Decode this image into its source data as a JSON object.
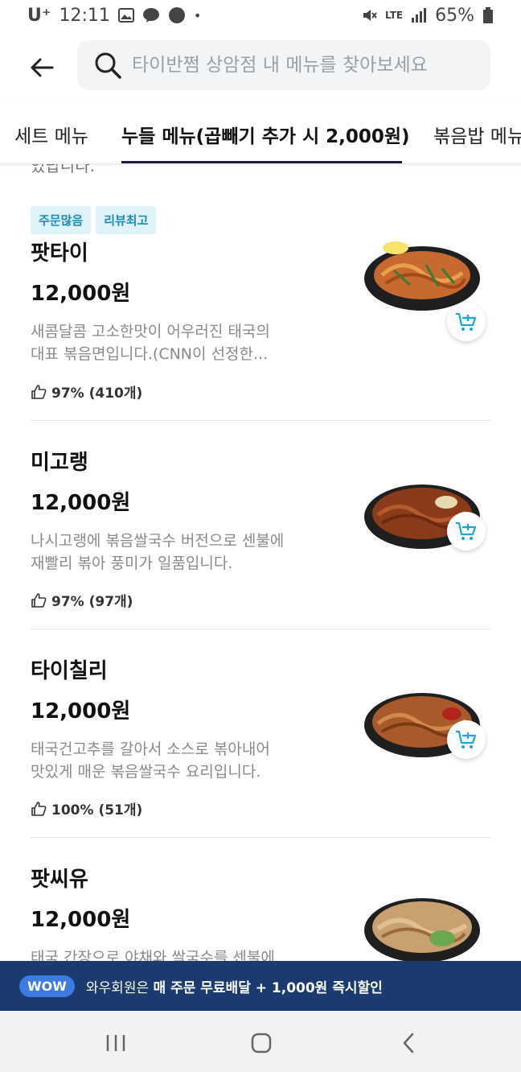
{
  "status_bar": {
    "carrier": "U⁺",
    "time": "12:11",
    "dot": "•",
    "network": "LTE",
    "battery": "65%"
  },
  "search": {
    "placeholder": "타이반쩜 상암점 내 메뉴를 찾아보세요"
  },
  "tabs": [
    {
      "label": "세트 메뉴",
      "active": false
    },
    {
      "label": "누들 메뉴(곱빼기 추가 시 2,000원)",
      "active": true
    },
    {
      "label": "볶음밥 메뉴",
      "active": false
    }
  ],
  "cut_text": "있답니다.",
  "items": [
    {
      "badges": [
        "주문많음",
        "리뷰최고"
      ],
      "name": "팟타이",
      "price": "12,000원",
      "desc_line1": "새콤달콤 고소한맛이 어우러진 태국의",
      "desc_line2": "대표 볶음면입니다.(CNN이 선정한...",
      "rating": "97% (410개)"
    },
    {
      "badges": [],
      "name": "미고랭",
      "price": "12,000원",
      "desc_line1": "나시고랭에 볶음쌀국수 버전으로 센불에",
      "desc_line2": "재빨리 볶아 풍미가 일품입니다.",
      "rating": "97% (97개)"
    },
    {
      "badges": [],
      "name": "타이칠리",
      "price": "12,000원",
      "desc_line1": "태국건고추를 갈아서 소스로 볶아내어",
      "desc_line2": "맛있게 매운 볶음쌀국수 요리입니다.",
      "rating": "100% (51개)"
    },
    {
      "badges": [],
      "name": "팟씨유",
      "price": "12,000원",
      "desc_line1": "태국 간장으로 야채와 쌀국수를 센불에",
      "desc_line2": "",
      "rating": ""
    }
  ],
  "wow_banner": {
    "pill": "WOW",
    "text_prefix": "와우회원은 ",
    "text_bold": "매 주문 무료배달 + 1,000원 즉시할인"
  },
  "colors": {
    "accent": "#1c1c4a",
    "badge_bg": "#dff3fb",
    "badge_text": "#1a8bbf",
    "banner_bg": "#1b3a70",
    "cart_icon": "#19a6d8"
  },
  "icons": {
    "back": "arrow-left-icon",
    "search": "search-icon",
    "cart": "add-to-cart-icon",
    "thumb": "thumbs-up-icon"
  }
}
